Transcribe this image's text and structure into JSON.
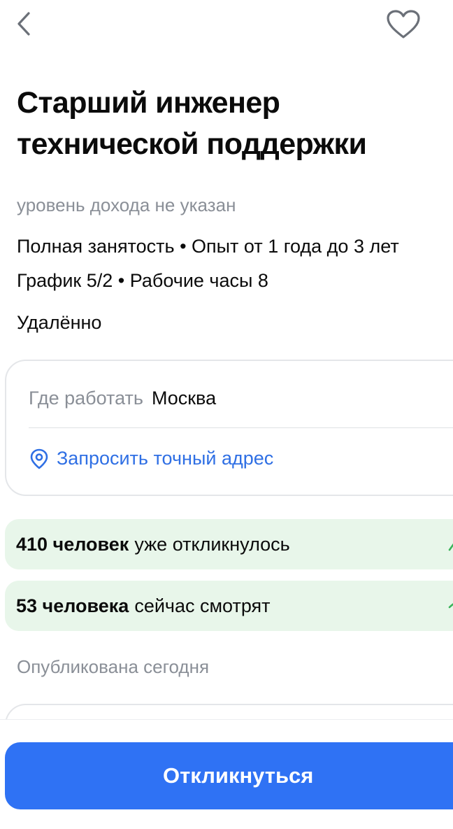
{
  "header": {
    "back_icon": "chevron-left-icon",
    "favorite_icon": "heart-outline-icon"
  },
  "vacancy": {
    "title_line1": "Старший инженер",
    "title_line2": "технической поддержки",
    "salary": "уровень дохода не указан",
    "details_line1": "Полная занятость • Опыт от 1 года до 3 лет",
    "details_line2": "График 5/2 • Рабочие часы 8",
    "work_format": "Удалённо"
  },
  "location": {
    "label": "Где работать",
    "value": "Москва",
    "request_address_label": "Запросить точный адрес",
    "request_icon": "location-pin-icon"
  },
  "stats": {
    "applied_count": "410 человек",
    "applied_text": "уже откликнулось",
    "viewing_count": "53 человека",
    "viewing_text": "сейчас смотрят",
    "accent_color": "#e8f6ea"
  },
  "published": "Опубликована сегодня",
  "actions": {
    "apply_label": "Откликнуться",
    "apply_color": "#2f72f4"
  }
}
